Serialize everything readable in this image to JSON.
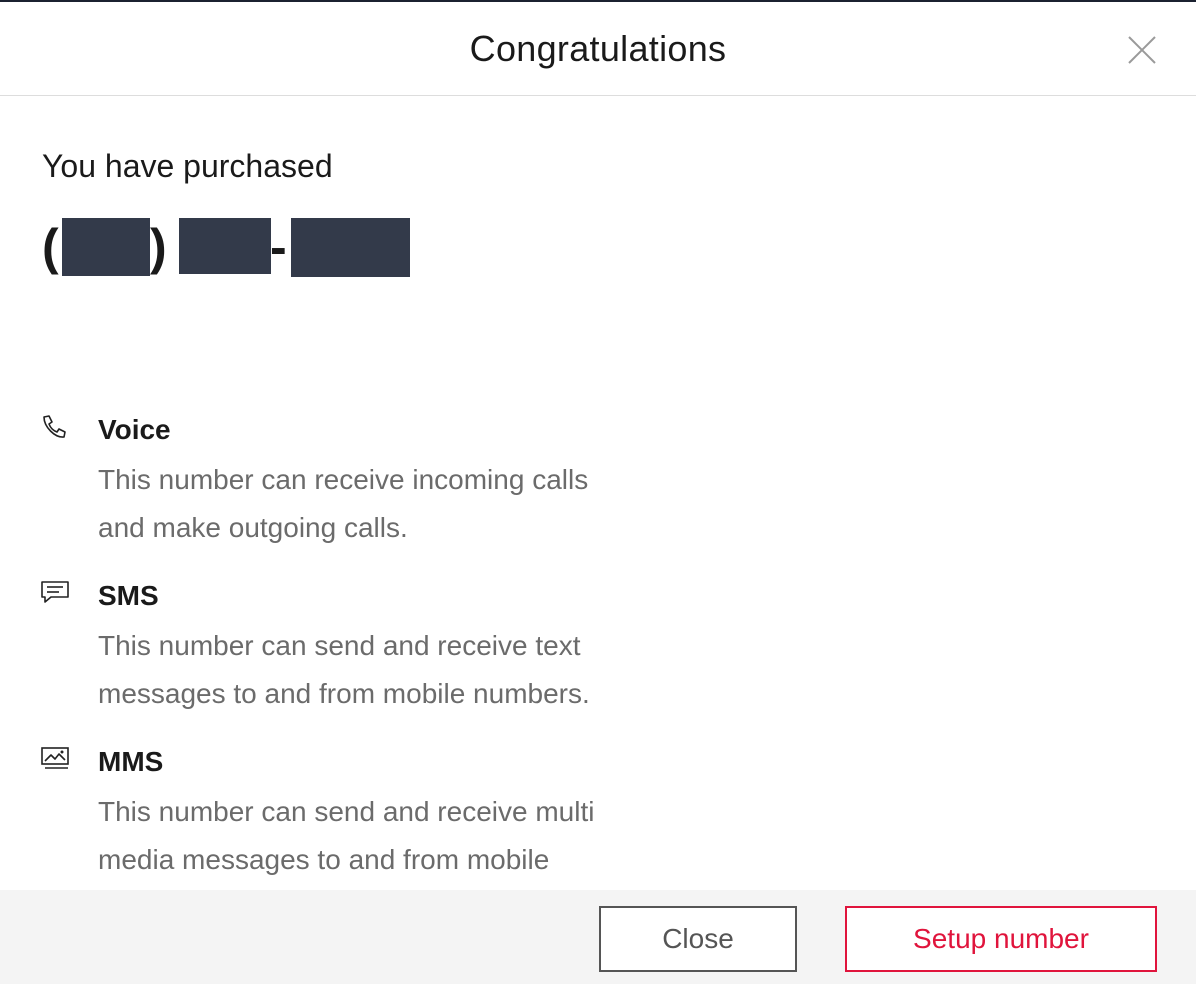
{
  "header": {
    "title": "Congratulations",
    "close_icon": "close-icon"
  },
  "main": {
    "purchased_label": "You have purchased",
    "phone_number": {
      "open_paren": "(",
      "close_paren": ")",
      "dash": "-",
      "digits_redacted": true
    },
    "features": [
      {
        "icon": "phone-icon",
        "name": "Voice",
        "description": "This number can receive incoming calls and make outgoing calls."
      },
      {
        "icon": "message-icon",
        "name": "SMS",
        "description": "This number can send and receive text messages to and from mobile numbers."
      },
      {
        "icon": "image-icon",
        "name": "MMS",
        "description": "This number can send and receive multi media messages to and from mobile numbers."
      }
    ]
  },
  "footer": {
    "close_label": "Close",
    "setup_label": "Setup number"
  },
  "colors": {
    "accent": "#e0143c",
    "redaction": "#333a4a",
    "footer_bg": "#f4f4f4",
    "muted_text": "#6b6b6b"
  }
}
